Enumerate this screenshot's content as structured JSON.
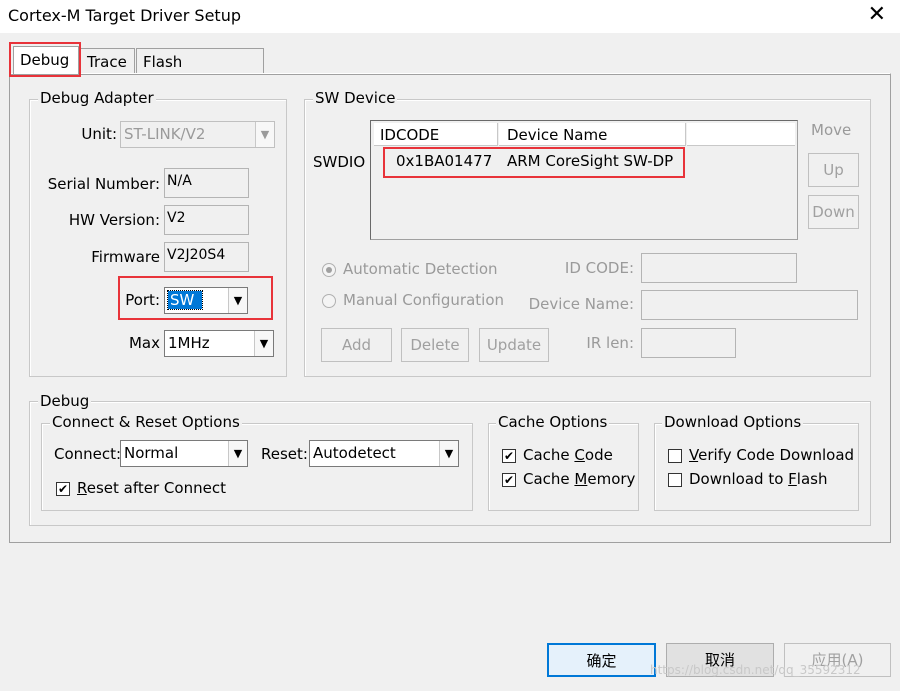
{
  "window": {
    "title": "Cortex-M Target Driver Setup",
    "close": "✕"
  },
  "tabs": [
    "Debug",
    "Trace",
    "Flash Download"
  ],
  "debug_adapter": {
    "legend": "Debug Adapter",
    "unit_label": "Unit:",
    "unit_value": "ST-LINK/V2",
    "serial_label": "Serial Number:",
    "serial_value": "N/A",
    "hw_label": "HW Version:",
    "hw_value": "V2",
    "firmware_label": "Firmware",
    "firmware_value": "V2J20S4",
    "port_label": "Port:",
    "port_value": "SW",
    "max_label": "Max",
    "max_value": "1MHz"
  },
  "sw_device": {
    "legend": "SW Device",
    "row_label": "SWDIO",
    "col_idcode": "IDCODE",
    "col_device": "Device Name",
    "idcode": "0x1BA01477",
    "device_name": "ARM CoreSight SW-DP",
    "move_label": "Move",
    "up": "Up",
    "down": "Down",
    "auto_detect": "Automatic Detection",
    "manual_config": "Manual Configuration",
    "id_code_label": "ID CODE:",
    "device_name_label": "Device Name:",
    "ir_len_label": "IR len:",
    "add": "Add",
    "delete": "Delete",
    "update": "Update"
  },
  "debug_section": {
    "legend": "Debug",
    "connect_reset_legend": "Connect & Reset Options",
    "connect_label": "Connect:",
    "connect_value": "Normal",
    "reset_label": "Reset:",
    "reset_value": "Autodetect",
    "reset_after_connect_prefix": "R",
    "reset_after_connect_rest": "eset after Connect",
    "cache_legend": "Cache Options",
    "cache_code_prefix": "Cache ",
    "cache_code_u": "C",
    "cache_code_rest": "ode",
    "cache_memory_prefix": "Cache ",
    "cache_memory_u": "M",
    "cache_memory_rest": "emory",
    "download_legend": "Download Options",
    "verify_u": "V",
    "verify_rest": "erify Code Download",
    "dl_prefix": "Download to ",
    "dl_u": "F",
    "dl_rest": "lash"
  },
  "footer": {
    "ok": "确定",
    "cancel": "取消",
    "apply": "应用(A)"
  },
  "watermark": "https://blog.csdn.net/qq_35592312",
  "colors": {
    "highlight": "#e8333a",
    "selection": "#0078d7"
  }
}
